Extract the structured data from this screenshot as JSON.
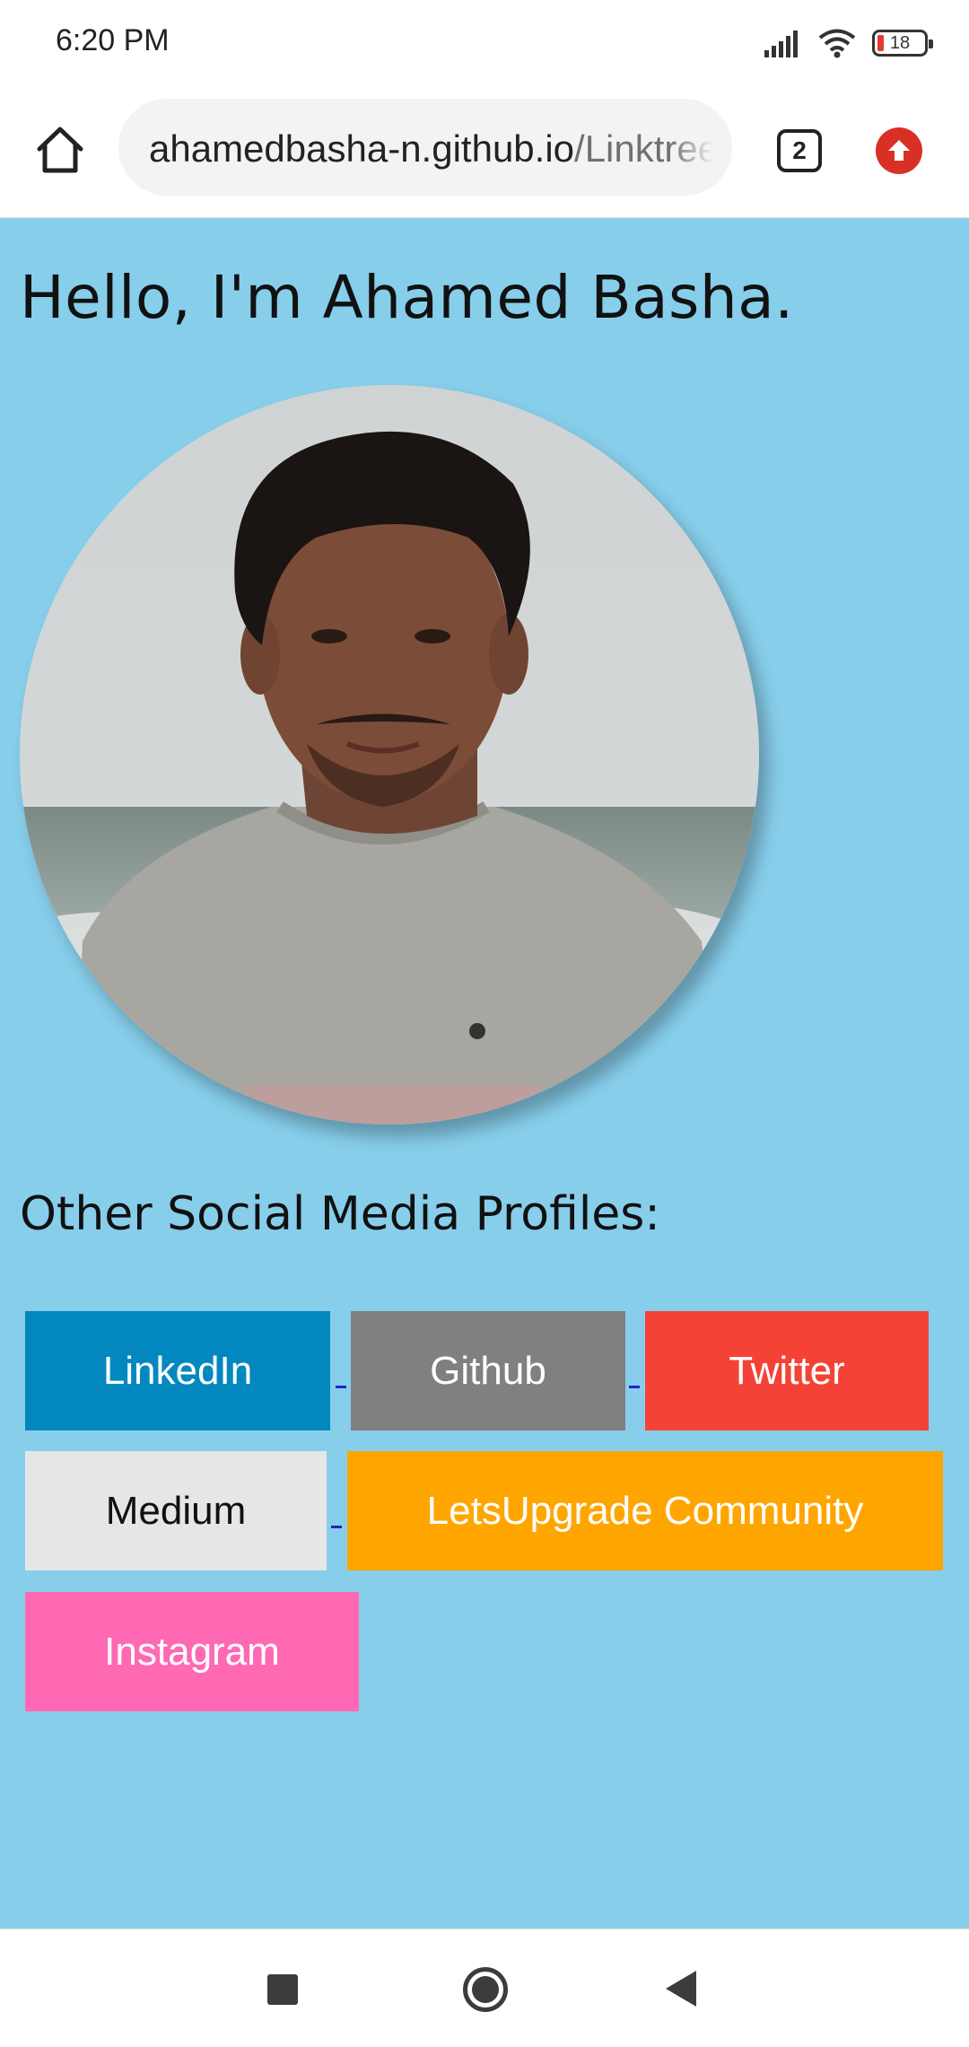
{
  "status_bar": {
    "time": "6:20 PM",
    "battery_level": "18",
    "icons": [
      "signal-icon",
      "wifi-icon",
      "battery-icon"
    ]
  },
  "browser": {
    "url_host": "ahamedbasha-n.github.io",
    "url_path": "/Linktree",
    "tab_count": "2",
    "icons": [
      "home-icon",
      "tab-switcher-icon",
      "update-icon"
    ]
  },
  "page": {
    "background": "#87ceeb",
    "title": "Hello, I'm Ahamed Basha.",
    "section_title": "Other Social Media Profiles:",
    "links": [
      {
        "label": "LinkedIn",
        "color": "#0288bf"
      },
      {
        "label": "Github",
        "color": "#808080"
      },
      {
        "label": "Twitter",
        "color": "#f44336"
      },
      {
        "label": "Medium",
        "color": "#e6e6e6"
      },
      {
        "label": "LetsUpgrade Community",
        "color": "#ffa500"
      },
      {
        "label": "Instagram",
        "color": "#ff69b4"
      }
    ]
  },
  "nav_bar": {
    "icons": [
      "recent-apps-icon",
      "home-icon",
      "back-icon"
    ]
  }
}
